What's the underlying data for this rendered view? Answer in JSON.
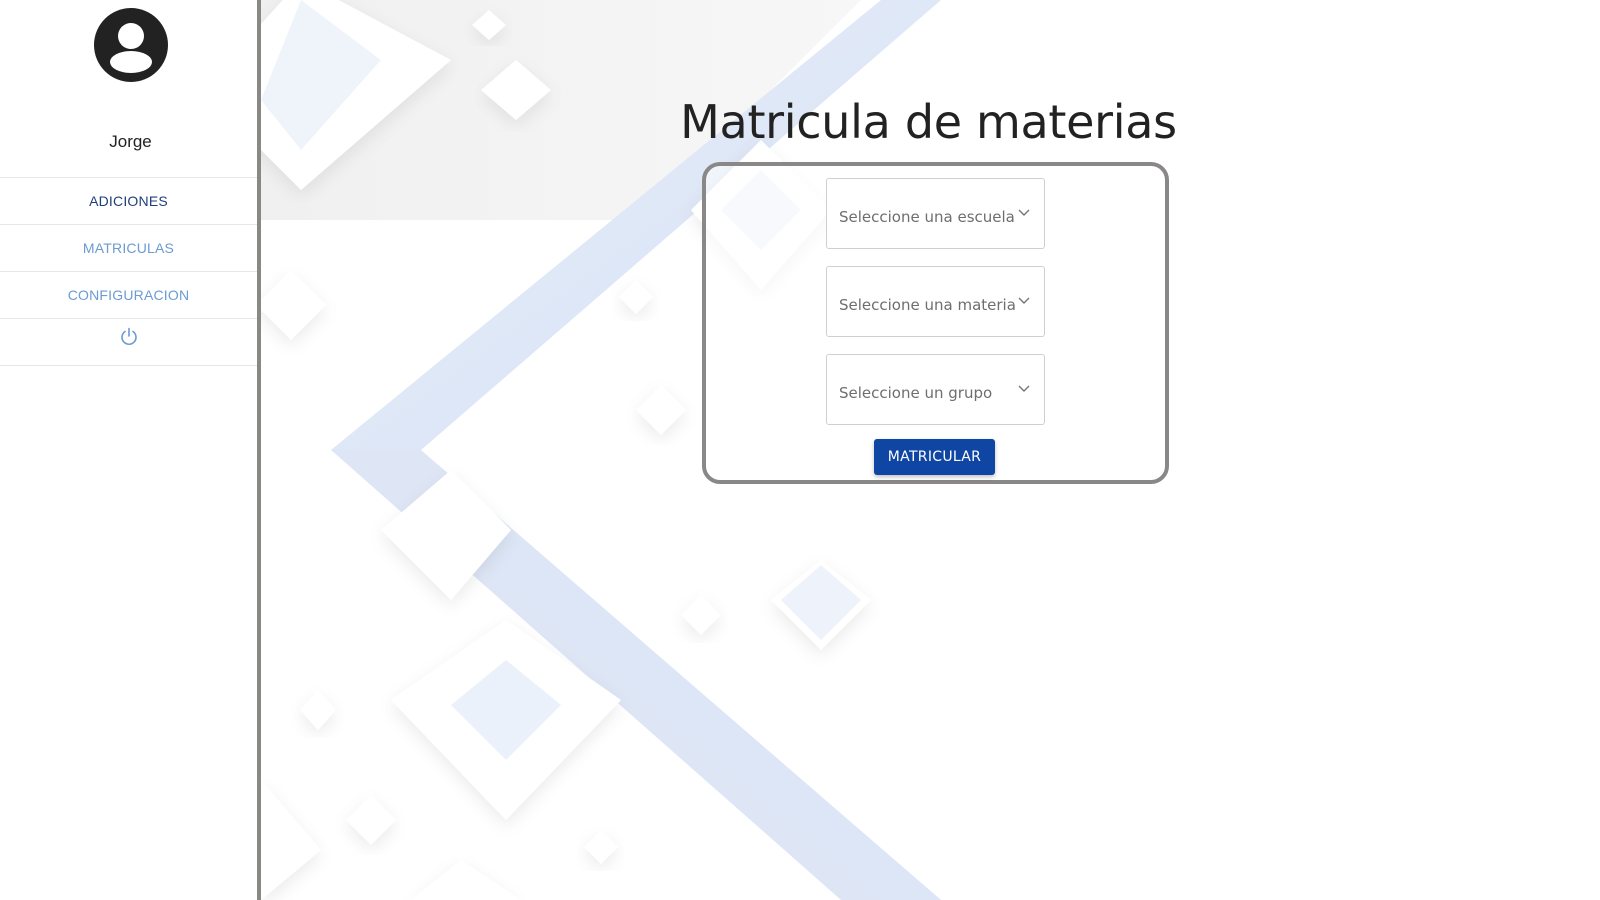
{
  "sidebar": {
    "user": {
      "name": "Jorge",
      "avatar_icon": "user-circle-icon"
    },
    "nav_items": [
      {
        "label": "ADICIONES",
        "state": "active"
      },
      {
        "label": "MATRICULAS",
        "state": "link"
      },
      {
        "label": "CONFIGURACION",
        "state": "link"
      }
    ],
    "logout_icon": "power-icon"
  },
  "main": {
    "title": "Matricula de materias",
    "form": {
      "school_select": {
        "placeholder": "Seleccione una escuela",
        "icon": "chevron-down-icon"
      },
      "subject_select": {
        "placeholder": "Seleccione una materia",
        "icon": "chevron-down-icon"
      },
      "group_select": {
        "placeholder": "Seleccione un grupo",
        "icon": "chevron-down-icon"
      },
      "submit_label": "MATRICULAR"
    }
  },
  "colors": {
    "accent": "#0f45a3",
    "sidebar_active": "#1f3f7a",
    "sidebar_link": "#6b9bd1",
    "border": "#8a8787",
    "background_tint": "#dbe5f6"
  }
}
